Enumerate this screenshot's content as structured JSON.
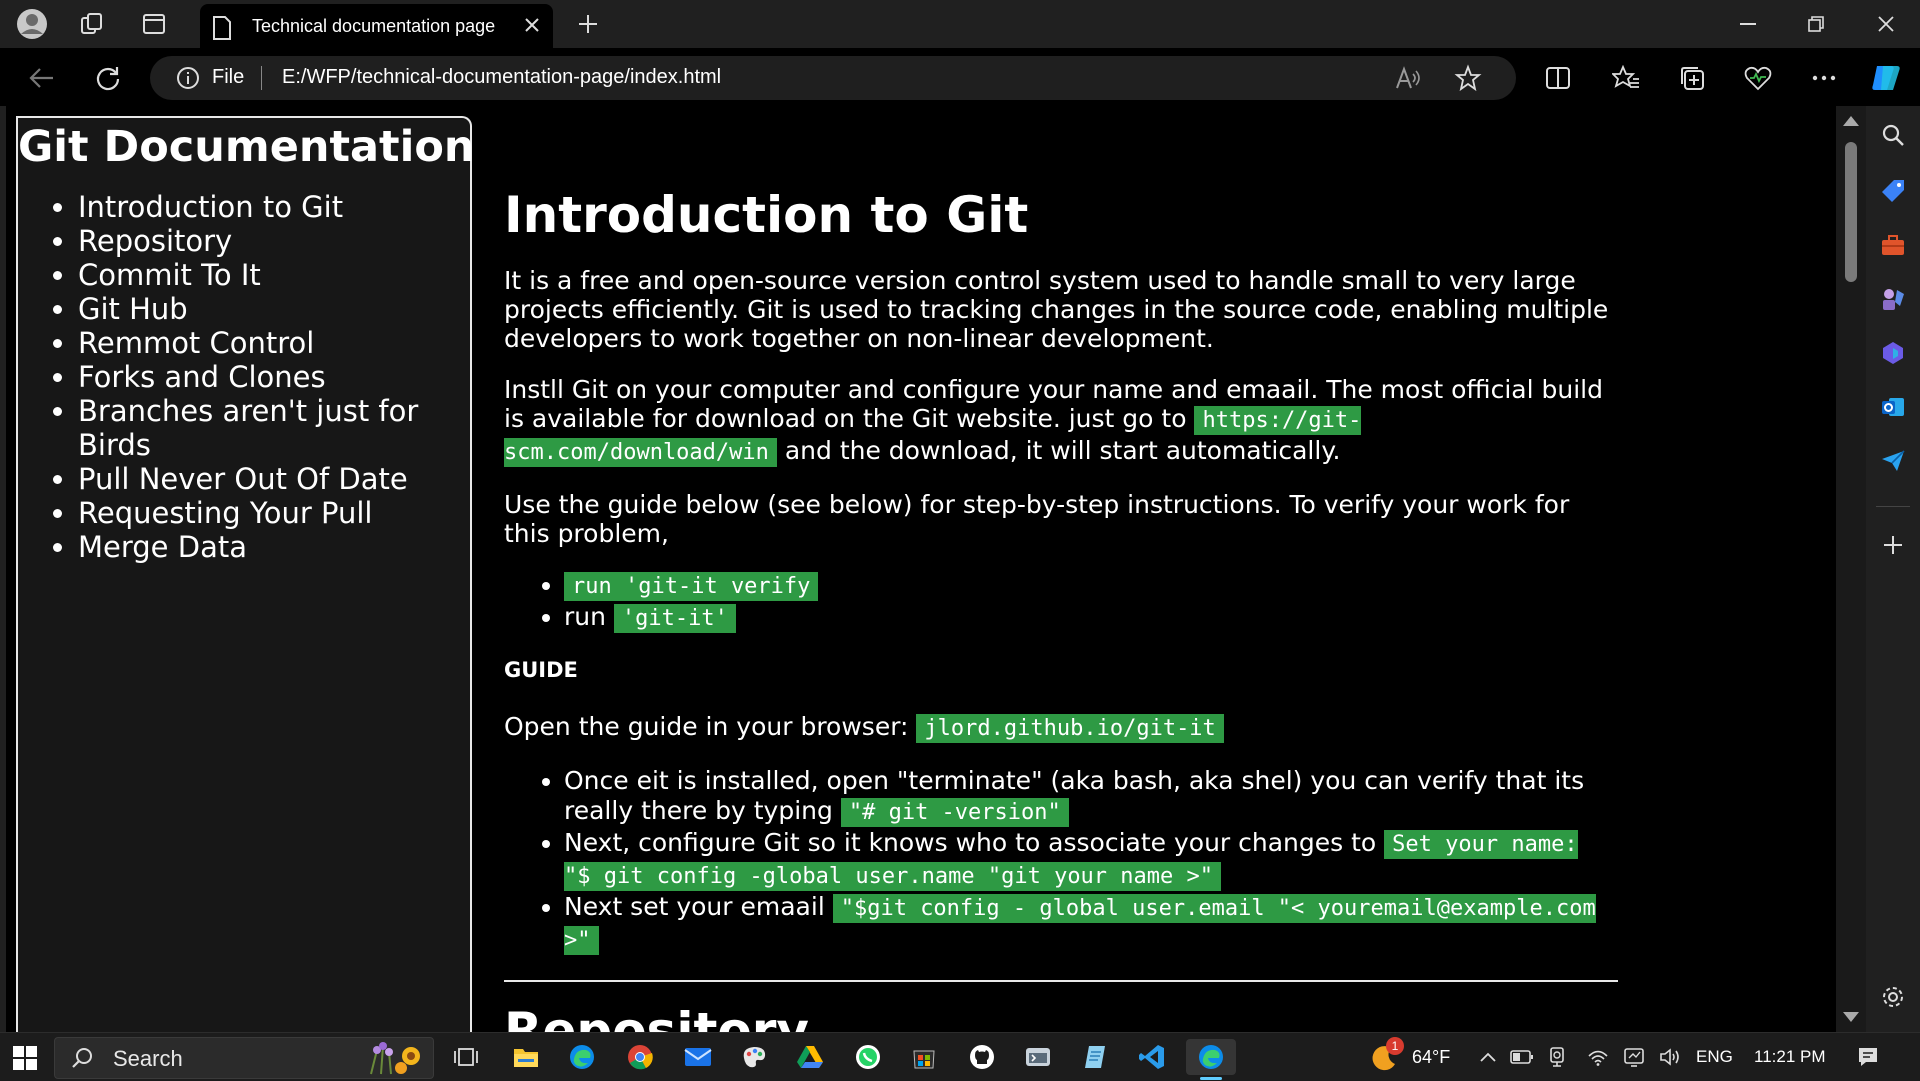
{
  "browser": {
    "tab_title": "Technical documentation page",
    "scheme_label": "File",
    "url": "E:/WFP/technical-documentation-page/index.html"
  },
  "sidebar": {
    "heading": "Git Documentation",
    "links": [
      "Introduction to Git",
      "Repository",
      "Commit To It",
      "Git Hub",
      "Remmot Control",
      "Forks and Clones",
      "Branches aren't just for Birds",
      "Pull Never Out Of Date",
      "Requesting Your Pull",
      "Merge Data"
    ]
  },
  "main": {
    "title": "Introduction to Git",
    "para1": "It is a free and open-source version control system used to handle small to very large projects efficiently. Git is used to tracking changes in the source code, enabling multiple developers to work together on non-linear development.",
    "para2_before": "Instll Git on your computer and configure your name and emaail. The most official build is available for download on the Git website. just go to ",
    "para2_code": "https://git-scm.com/download/win",
    "para2_after": " and the download, it will start automatically.",
    "para3": "Use the guide below (see below) for step-by-step instructions. To verify your work for this problem,",
    "verify_list": {
      "item1_code": "run 'git-it verify",
      "item2_text": "run ",
      "item2_code": "'git-it'"
    },
    "guide_heading": "GUIDE",
    "guide_text": "Open the guide in your browser: ",
    "guide_code": "jlord.github.io/git-it",
    "steps": {
      "s1_text": "Once eit is installed, open \"terminate\" (aka bash, aka shel) you can verify that its really there by typing ",
      "s1_code": "\"# git -version\"",
      "s2_text": "Next, configure Git so it knows who to associate your changes to ",
      "s2_code": "Set your name: \"$ git config -global user.name \"git your name >\"",
      "s3_text": "Next set your emaail ",
      "s3_code": "\"$git config - global user.email \"< youremail@example.com >\""
    },
    "next_title": "Repository"
  },
  "taskbar": {
    "search_label": "Search",
    "weather": "64°F",
    "weather_badge": "1",
    "language": "ENG",
    "time": "11:21 PM"
  },
  "colors": {
    "code_bg": "#2e9a44",
    "page_bg": "#000000",
    "sidebar_bg": "#171717"
  }
}
